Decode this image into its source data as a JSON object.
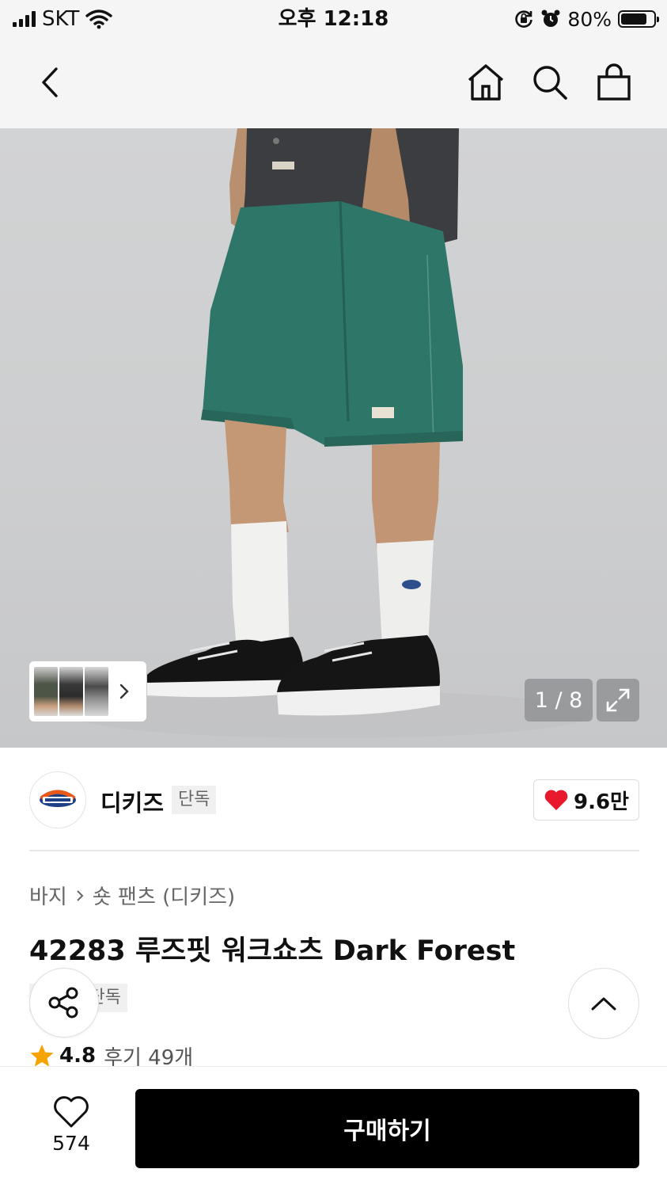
{
  "status_bar": {
    "carrier": "SKT",
    "time": "오후 12:18",
    "battery": "80%",
    "battery_level": 0.8
  },
  "nav": {
    "icons": [
      "back-icon",
      "home-icon",
      "search-icon",
      "shopping-bag-icon"
    ]
  },
  "gallery": {
    "counter": "1 / 8",
    "current_index": 1,
    "total": 8
  },
  "brand": {
    "name": "디키즈",
    "badge": "단독",
    "like_count": "9.6만"
  },
  "product": {
    "breadcrumb": [
      "바지",
      "숏 팬츠 (디키즈)"
    ],
    "title": "42283 루즈핏 워크쇼츠 Dark Forest",
    "exclusive_badge": "단독",
    "rating": "4.8",
    "review_link": "후기 49개"
  },
  "bottom_bar": {
    "wish_count": "574",
    "buy_label": "구매하기"
  },
  "colors": {
    "accent_red": "#e8192c",
    "star_orange": "#f5a300",
    "buy_button": "#000000",
    "shorts_green": "#2e7667"
  }
}
